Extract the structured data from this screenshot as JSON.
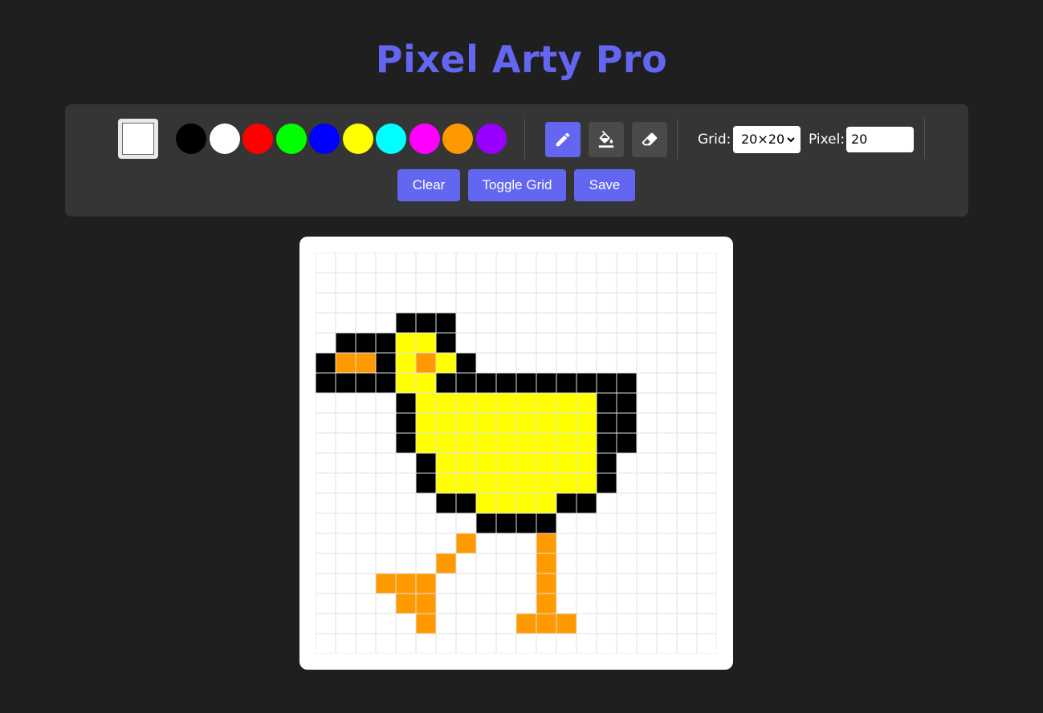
{
  "app": {
    "title": "Pixel Arty Pro"
  },
  "toolbar": {
    "current_color": "#ffffff",
    "palette": [
      "#000000",
      "#ffffff",
      "#ff0000",
      "#00ff00",
      "#0000ff",
      "#ffff00",
      "#00ffff",
      "#ff00ff",
      "#ff9900",
      "#9900ff"
    ],
    "tools": [
      {
        "name": "pencil",
        "icon": "pencil-icon",
        "active": true
      },
      {
        "name": "fill",
        "icon": "paint-bucket-icon",
        "active": false
      },
      {
        "name": "eraser",
        "icon": "eraser-icon",
        "active": false
      }
    ],
    "grid_label": "Grid:",
    "grid_value": "20×20",
    "pixel_label": "Pixel:",
    "pixel_value": "20",
    "clear_label": "Clear",
    "toggle_grid_label": "Toggle Grid",
    "save_label": "Save"
  },
  "canvas": {
    "rows": 20,
    "cols": 20,
    "grid_visible": true,
    "grid_line_color": "#e0e0e0",
    "background_color": "#ffffff",
    "colors": {
      "K": "#000000",
      "Y": "#ffff00",
      "O": "#ff9900"
    },
    "pixels": [
      "....................",
      "....................",
      "....................",
      "....KKK.............",
      ".KKKYYK.............",
      "KOOKYOYK............",
      "KKKKYYKKKKKKKKKK....",
      "....KYYYYYYYYYKK....",
      "....KYYYYYYYYYKK....",
      "....KYYYYYYYYYKK....",
      ".....KYYYYYYYYK.....",
      ".....KYYYYYYYYK.....",
      "......KKYYYYKK......",
      "........KKKK........",
      ".......O...O........",
      "......O....O........",
      "...OOO.....O........",
      "....OO.....O........",
      ".....O....OOO.......",
      "...................."
    ]
  }
}
